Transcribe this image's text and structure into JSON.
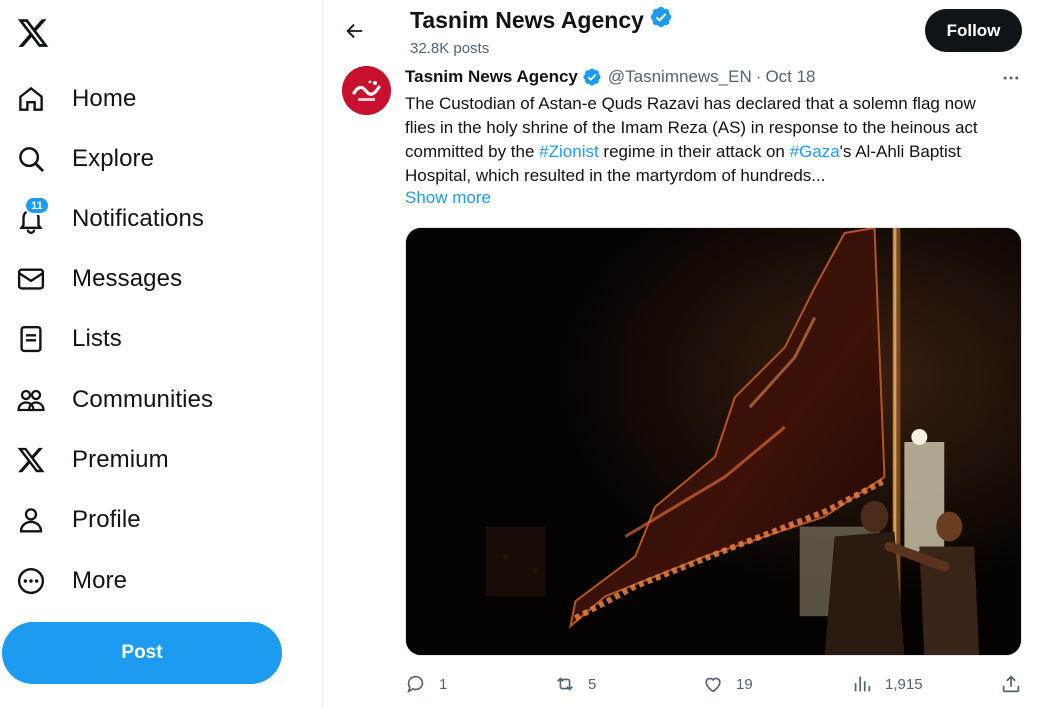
{
  "sidebar": {
    "logo_icon": "x-logo-icon",
    "items": [
      {
        "label": "Home",
        "icon": "home-icon"
      },
      {
        "label": "Explore",
        "icon": "search-icon"
      },
      {
        "label": "Notifications",
        "icon": "bell-icon",
        "badge": "11"
      },
      {
        "label": "Messages",
        "icon": "envelope-icon"
      },
      {
        "label": "Lists",
        "icon": "list-icon"
      },
      {
        "label": "Communities",
        "icon": "people-icon"
      },
      {
        "label": "Premium",
        "icon": "x-logo-icon"
      },
      {
        "label": "Profile",
        "icon": "person-icon"
      },
      {
        "label": "More",
        "icon": "more-circle-icon"
      }
    ],
    "post_label": "Post"
  },
  "header": {
    "title": "Tasnim News Agency",
    "posts_count": "32.8K posts",
    "follow_label": "Follow"
  },
  "tweet": {
    "author_name": "Tasnim News Agency",
    "handle": "@Tasnimnews_EN",
    "separator": "·",
    "date": "Oct 18",
    "text_1": "The Custodian of Astan-e Quds Razavi has declared that a solemn flag now flies in the holy shrine of the Imam Reza (AS) in response to the heinous act committed by the ",
    "hashtag_1": "#Zionist",
    "text_2": " regime in their attack on ",
    "hashtag_2": "#Gaza",
    "text_3": "'s Al-Ahli Baptist Hospital, which resulted in the martyrdom of hundreds...",
    "show_more": "Show more",
    "actions": {
      "replies": "1",
      "reposts": "5",
      "likes": "19",
      "views": "1,915"
    }
  },
  "colors": {
    "accent": "#1d9bf0",
    "text": "#0f1419",
    "muted": "#536471",
    "brand_avatar": "#c8102e"
  }
}
